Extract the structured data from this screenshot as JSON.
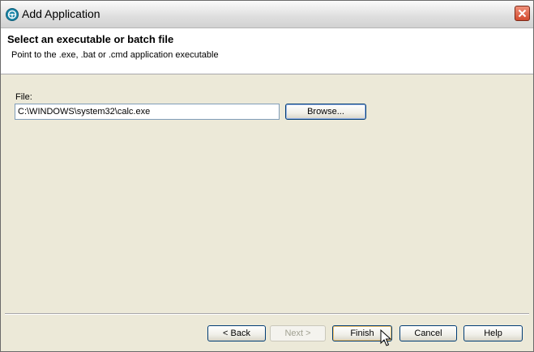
{
  "window": {
    "title": "Add Application",
    "icons": {
      "app": "steering-wheel-icon",
      "close": "close-icon"
    }
  },
  "header": {
    "title": "Select an executable or batch file",
    "description": "Point to the .exe, .bat or .cmd application executable"
  },
  "form": {
    "file_label": "File:",
    "file_value": "C:\\WINDOWS\\system32\\calc.exe",
    "browse_label": "Browse..."
  },
  "footer": {
    "back_label": "< Back",
    "next_label": "Next >",
    "finish_label": "Finish",
    "cancel_label": "Cancel",
    "help_label": "Help"
  },
  "colors": {
    "dialog_bg": "#ece9d8",
    "header_bg": "#ffffff",
    "button_border": "#003c74",
    "close_button": "#d24a2e"
  }
}
